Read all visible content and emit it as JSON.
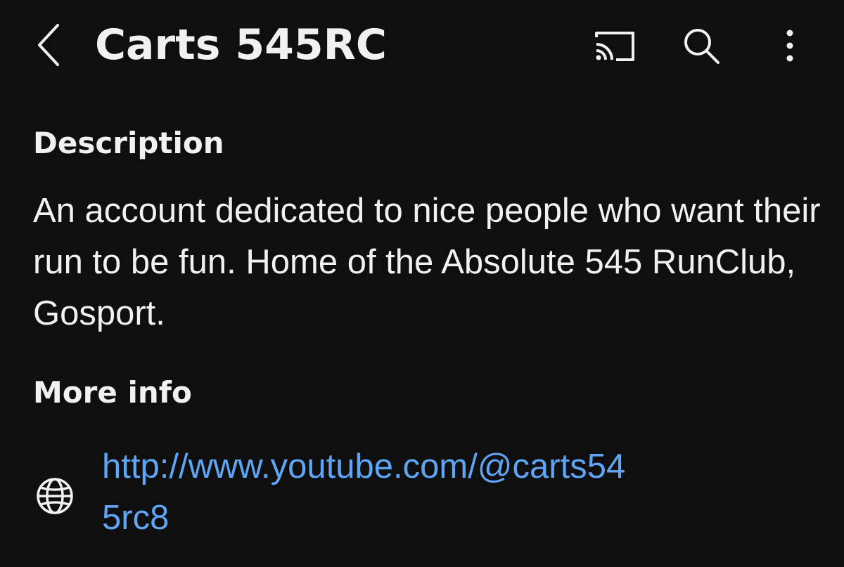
{
  "header": {
    "title": "Carts 545RC",
    "icons": {
      "back": "chevron-left-icon",
      "cast": "cast-icon",
      "search": "search-icon",
      "more": "more-vertical-icon"
    }
  },
  "description": {
    "heading": "Description",
    "text": "An account dedicated to nice people who want their run to be fun. Home of the Absolute 545 RunClub, Gosport."
  },
  "more_info": {
    "heading": "More info",
    "links": [
      {
        "icon": "globe-icon",
        "text": "http://www.youtube.com/@carts545rc8"
      }
    ]
  },
  "colors": {
    "background": "#0f0f0f",
    "text": "#f1f1f1",
    "link": "#5ea6f5"
  }
}
